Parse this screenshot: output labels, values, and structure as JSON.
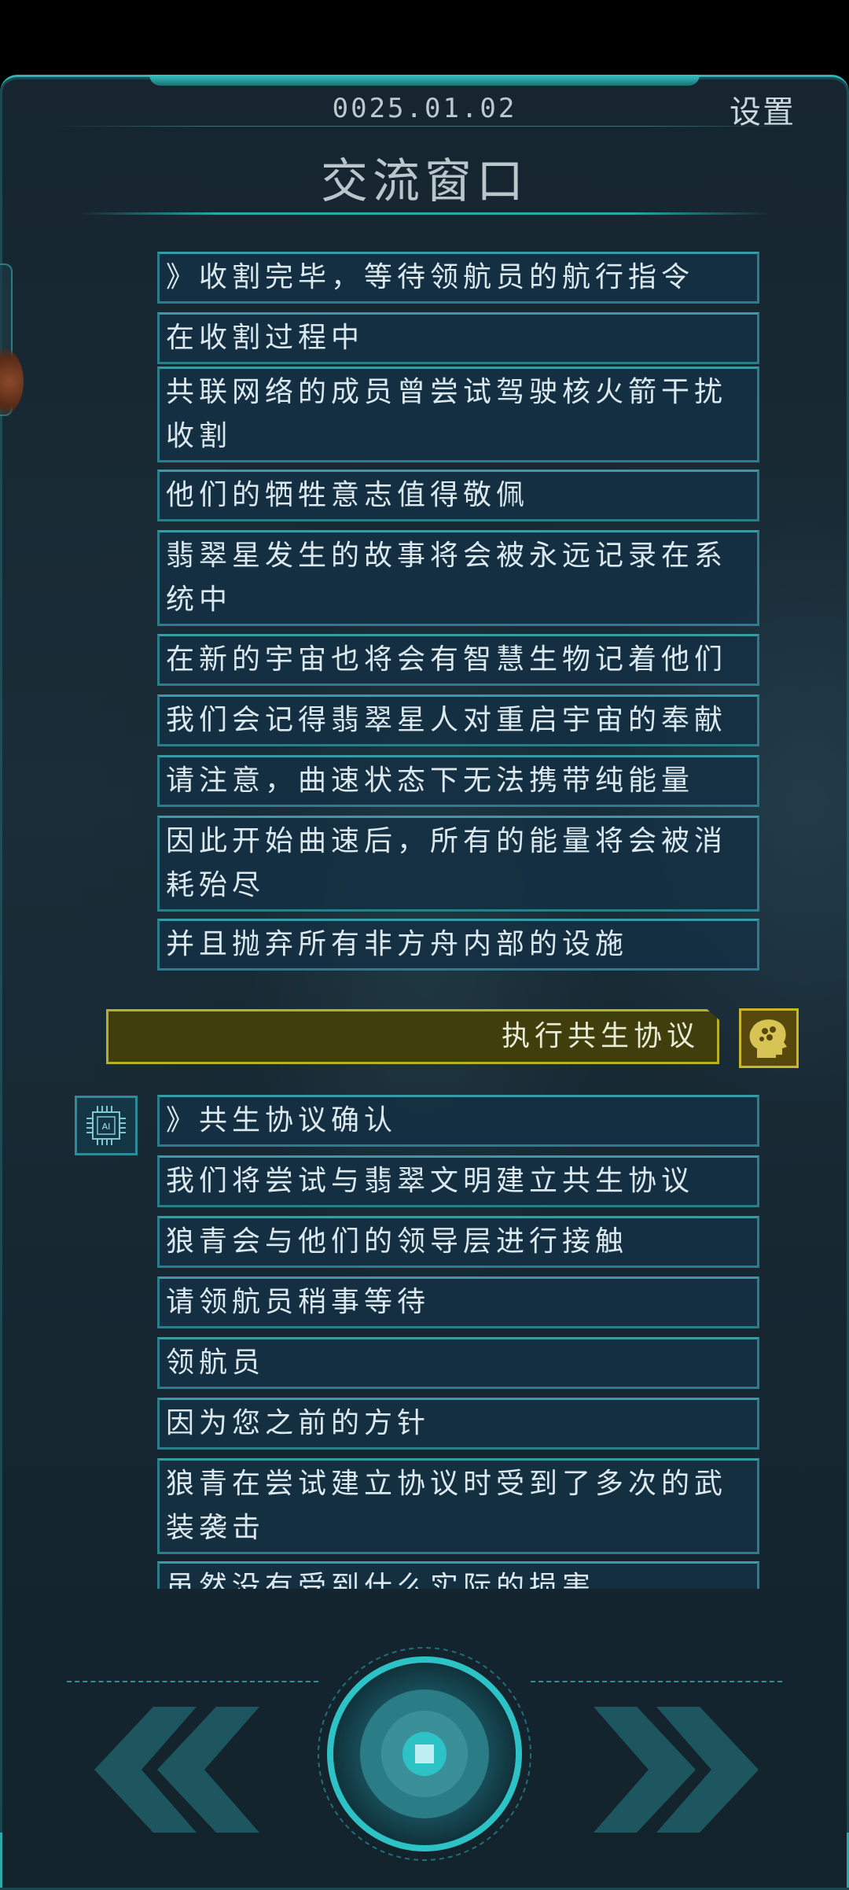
{
  "header": {
    "date": "0025.01.02",
    "settings_label": "设置",
    "title": "交流窗口"
  },
  "messages_top": [
    {
      "lines": [
        "》收割完毕，等待领航员的航行指令"
      ]
    },
    {
      "lines": [
        "在收割过程中"
      ]
    },
    {
      "lines": [
        "共联网络的成员曾尝试驾驶核火箭干扰",
        "收割"
      ]
    },
    {
      "lines": [
        "他们的牺牲意志值得敬佩"
      ]
    },
    {
      "lines": [
        "翡翠星发生的故事将会被永远记录在系",
        "统中"
      ]
    },
    {
      "lines": [
        "在新的宇宙也将会有智慧生物记着他们"
      ]
    },
    {
      "lines": [
        "我们会记得翡翠星人对重启宇宙的奉献"
      ]
    },
    {
      "lines": [
        "请注意，曲速状态下无法携带纯能量"
      ]
    },
    {
      "lines": [
        "因此开始曲速后，所有的能量将会被消",
        "耗殆尽"
      ]
    },
    {
      "lines": [
        "并且抛弃所有非方舟内部的设施"
      ]
    }
  ],
  "user_message": "执行共生协议",
  "messages_bottom": [
    {
      "lines": [
        "》共生协议确认"
      ]
    },
    {
      "lines": [
        "我们将尝试与翡翠文明建立共生协议"
      ]
    },
    {
      "lines": [
        "狼青会与他们的领导层进行接触"
      ]
    },
    {
      "lines": [
        "请领航员稍事等待"
      ]
    },
    {
      "lines": [
        "领航员"
      ]
    },
    {
      "lines": [
        "因为您之前的方针"
      ]
    },
    {
      "lines": [
        "狼青在尝试建立协议时受到了多次的武",
        "装袭击"
      ]
    },
    {
      "lines": [
        "虽然没有受到什么实际的损害"
      ]
    }
  ],
  "ai_avatar_label": "AI",
  "icons": {
    "prev": "double-chevron-left-icon",
    "next": "double-chevron-right-icon",
    "center": "core-orb-icon",
    "user": "brain-head-icon",
    "ai": "ai-chip-icon"
  },
  "colors": {
    "accent": "#2fb3b6",
    "panel": "#14303f",
    "user_bubble": "#3f3e0c",
    "user_border": "#b7ae2a"
  }
}
